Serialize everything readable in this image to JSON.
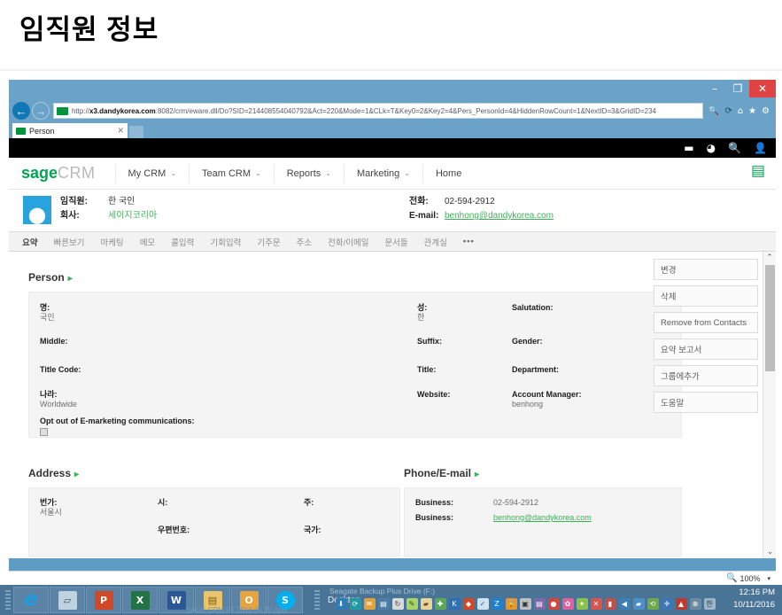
{
  "slide": {
    "title": "임직원 정보"
  },
  "browser": {
    "window_controls": {
      "minimize": "–",
      "restore": "❐",
      "close": "✕"
    },
    "nav": {
      "back": "←",
      "forward": "→"
    },
    "address": {
      "host": "x3.dandykorea.com",
      "prefix": "http://",
      "path": ":8082/crm/eware.dll/Do?SID=214408554040792&Act=220&Mode=1&CLk=T&Key0=2&Key2=4&Pers_PersonId=4&HiddenRowCount=1&NextID=3&GridID=234",
      "search_icon": "🔍",
      "refresh_icon": "⟳",
      "home_icon": "⌂",
      "favorites_icon": "★",
      "tools_icon": "⚙"
    },
    "tab": {
      "title": "Person",
      "close": "✕"
    }
  },
  "topbar": {
    "icons": [
      {
        "name": "chat-icon",
        "glyph": "▬"
      },
      {
        "name": "clock-icon",
        "glyph": "◕"
      },
      {
        "name": "search-icon",
        "glyph": "🔍"
      },
      {
        "name": "user-icon",
        "glyph": "👤"
      }
    ]
  },
  "sagenav": {
    "logo_primary": "sage",
    "logo_secondary": "CRM",
    "items": [
      {
        "label": "My CRM",
        "caret": "⌄"
      },
      {
        "label": "Team CRM",
        "caret": "⌄"
      },
      {
        "label": "Reports",
        "caret": "⌄"
      },
      {
        "label": "Marketing",
        "caret": "⌄"
      },
      {
        "label": "Home",
        "caret": ""
      }
    ],
    "new_record_icon": "▤"
  },
  "summary": {
    "avatar_glyph": "●",
    "left": [
      {
        "label": "임직원:",
        "value": "한 국인",
        "link": false
      },
      {
        "label": "회사:",
        "value": "세이지코리아",
        "link": true
      }
    ],
    "right": [
      {
        "label": "전화:",
        "value": "02-594-2912",
        "link": false
      },
      {
        "label": "E-mail:",
        "value": "benhong@dandykorea.com",
        "link": true
      }
    ]
  },
  "crm_tabs": [
    {
      "label": "요약",
      "active": true
    },
    {
      "label": "빠른보기",
      "active": false
    },
    {
      "label": "마케팅",
      "active": false
    },
    {
      "label": "메모",
      "active": false
    },
    {
      "label": "콜입력",
      "active": false
    },
    {
      "label": "기회입력",
      "active": false
    },
    {
      "label": "기주문",
      "active": false
    },
    {
      "label": "주소",
      "active": false
    },
    {
      "label": "전화/이메일",
      "active": false
    },
    {
      "label": "문서들",
      "active": false
    },
    {
      "label": "관계실",
      "active": false
    },
    {
      "label": "•••",
      "active": false
    }
  ],
  "person_panel": {
    "title": "Person",
    "arrow": "▸",
    "col1": [
      {
        "key": "명:",
        "value": "국인"
      },
      {
        "key": "Middle:",
        "value": ""
      },
      {
        "key": "Title Code:",
        "value": ""
      },
      {
        "key": "나라:",
        "value": "Worldwide"
      },
      {
        "key": "Opt out of E-marketing communications:",
        "value": ""
      }
    ],
    "col2": [
      {
        "key": "성:",
        "value": "한"
      },
      {
        "key": "Suffix:",
        "value": ""
      },
      {
        "key": "Title:",
        "value": ""
      },
      {
        "key": "Website:",
        "value": ""
      }
    ],
    "col3": [
      {
        "key": "Salutation:",
        "value": ""
      },
      {
        "key": "Gender:",
        "value": ""
      },
      {
        "key": "Department:",
        "value": ""
      },
      {
        "key": "Account Manager:",
        "value": "benhong"
      }
    ]
  },
  "address_panel": {
    "title": "Address",
    "arrow": "▸",
    "col1": [
      {
        "key": "번가:",
        "value": "서울시"
      }
    ],
    "col2": [
      {
        "key": "시:",
        "value": ""
      },
      {
        "key": "우편번호:",
        "value": ""
      }
    ],
    "col3": [
      {
        "key": "주:",
        "value": ""
      },
      {
        "key": "국가:",
        "value": ""
      }
    ]
  },
  "phone_panel": {
    "title": "Phone/E-mail",
    "arrow": "▸",
    "rows": [
      {
        "key": "Business:",
        "value": "02-594-2912",
        "mail": false
      },
      {
        "key": "Business:",
        "value": "benhong@dandykorea.com",
        "mail": true
      }
    ]
  },
  "actions": [
    {
      "label": "변경"
    },
    {
      "label": "삭제"
    },
    {
      "label": "Remove from Contacts"
    },
    {
      "label": "요약 보고서"
    },
    {
      "label": "그룹에추가"
    },
    {
      "label": "도움말"
    }
  ],
  "scrollbar": {
    "up": "⌃",
    "down": "⌄"
  },
  "statusbar": {
    "zoom_icon": "🔍",
    "zoom_level": "100%",
    "caret": "▾"
  },
  "taskbar": {
    "apps": [
      {
        "name": "internet-explorer",
        "glyph": "e"
      },
      {
        "name": "notepad",
        "glyph": "▱"
      },
      {
        "name": "powerpoint",
        "glyph": "P"
      },
      {
        "name": "excel",
        "glyph": "X"
      },
      {
        "name": "word",
        "glyph": "W"
      },
      {
        "name": "file-explorer",
        "glyph": "▤"
      },
      {
        "name": "outlook",
        "glyph": "O"
      },
      {
        "name": "skype",
        "glyph": "S"
      }
    ],
    "desktop_label": "Desktop",
    "tray_label": "Seagate Backup Plus Drive (F:)",
    "ghost_line": "SAGE CRM PT  2016 04 27.pptx",
    "time": "12:16 PM",
    "date": "10/11/2016"
  }
}
